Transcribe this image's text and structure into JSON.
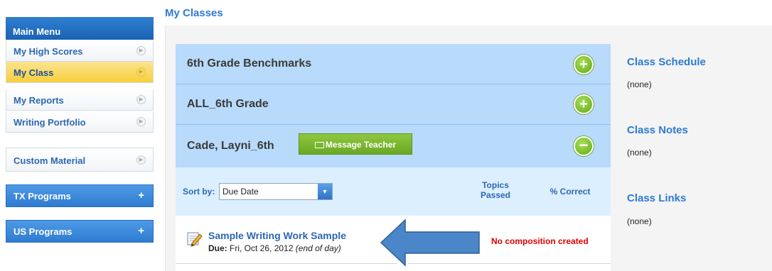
{
  "page_title": "My Classes",
  "menu": {
    "header": "Main Menu",
    "items": [
      {
        "label": "My High Scores"
      },
      {
        "label": "My Class"
      },
      {
        "label": "My Reports"
      },
      {
        "label": "Writing Portfolio"
      }
    ],
    "custom_material": "Custom Material",
    "tx_programs": "TX Programs",
    "us_programs": "US Programs"
  },
  "classes": [
    {
      "name": "6th Grade Benchmarks",
      "toggle": "+"
    },
    {
      "name": "ALL_6th Grade",
      "toggle": "+"
    },
    {
      "name": "Cade, Layni_6th",
      "toggle": "−"
    }
  ],
  "message_button": "Message Teacher",
  "sort": {
    "label": "Sort by:",
    "value": "Due Date"
  },
  "columns": {
    "topics_line1": "Topics",
    "topics_line2": "Passed",
    "correct": "% Correct"
  },
  "assignment": {
    "title": "Sample Writing Work Sample",
    "due_label": "Due:",
    "due_date": "Fri, Oct 26, 2012",
    "due_note": "(end of day)",
    "status": "No composition created"
  },
  "sidebar": {
    "schedule_title": "Class Schedule",
    "schedule_value": "(none)",
    "notes_title": "Class Notes",
    "notes_value": "(none)",
    "links_title": "Class Links",
    "links_value": "(none)"
  },
  "colors": {
    "menu_active": "#f7cf3c",
    "accent_blue": "#2d7ad4",
    "class_row": "#b8dafb",
    "toggle_green": "#6aa832",
    "status_red": "#e00000",
    "arrow_blue": "#4a86c8"
  }
}
